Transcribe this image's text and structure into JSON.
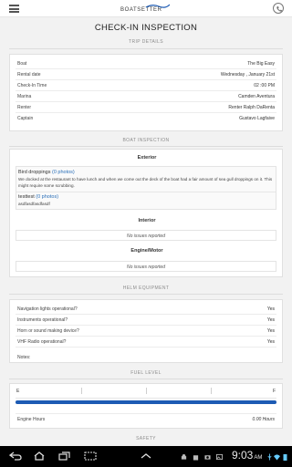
{
  "header": {
    "brand_label": "BOATSETTER",
    "page_title": "CHECK-IN INSPECTION",
    "colors": {
      "accent": "#1d5bb4",
      "link": "#2a6fb8"
    }
  },
  "trip_details": {
    "section_label": "TRIP DETAILS",
    "rows": [
      {
        "key": "Boat",
        "value": "The Big Easy"
      },
      {
        "key": "Rental date",
        "value": "Wednesday , January 21st"
      },
      {
        "key": "Check-In Time",
        "value": "02 :00 PM"
      },
      {
        "key": "Marina",
        "value": "Camden Aventura"
      },
      {
        "key": "Renter",
        "value": "Renter Ralph DaRenta"
      },
      {
        "key": "Captain",
        "value": "Gustavo Lagfaive"
      }
    ]
  },
  "boat_inspection": {
    "section_label": "BOAT INSPECTION",
    "exterior": {
      "heading": "Exterior",
      "issues": [
        {
          "title": "Bird droppings",
          "photos": "(0 photos)",
          "body": "We docked at the restaurant to have lunch and when we come out the deck of the boat had a fair amount of sea gull droppings on it. This might require some scrubbing."
        },
        {
          "title": "testtest",
          "photos": "(0 photos)",
          "body": "asdfasdfasdfasdf"
        }
      ]
    },
    "interior": {
      "heading": "Interior",
      "status": "No issues reported"
    },
    "engine": {
      "heading": "Engine/Motor",
      "status": "No issues reported"
    }
  },
  "helm_equipment": {
    "section_label": "HELM EQUIPMENT",
    "rows": [
      {
        "key": "Navigation lights operational?",
        "value": "Yes"
      },
      {
        "key": "Instruments operational?",
        "value": "Yes"
      },
      {
        "key": "Horn or sound making device?",
        "value": "Yes"
      },
      {
        "key": "VHF Radio operational?",
        "value": "Yes"
      }
    ],
    "notes_label": "Notes:"
  },
  "fuel_level": {
    "section_label": "FUEL LEVEL",
    "empty_label": "E",
    "full_label": "F",
    "level_fraction": 1.0,
    "engine_hours_label": "Engine Hours",
    "engine_hours_value": "0.00 Hours"
  },
  "safety": {
    "section_label": "SAFETY"
  },
  "system_bar": {
    "time": "9:03",
    "ampm": "AM",
    "icons": [
      "back-icon",
      "home-icon",
      "recents-icon",
      "screenshot-icon",
      "chevron-up-icon",
      "android-icon",
      "shopping-bag-icon",
      "camera-icon",
      "image-icon",
      "usb-icon",
      "wifi-icon",
      "battery-icon"
    ]
  }
}
